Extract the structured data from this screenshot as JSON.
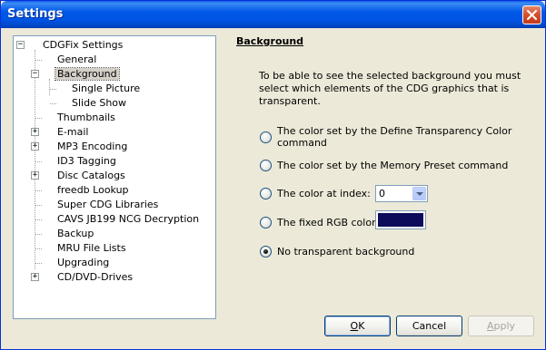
{
  "window": {
    "title": "Settings"
  },
  "tree": {
    "items": [
      {
        "label": "CDGFix Settings",
        "expander": "minus"
      },
      {
        "label": "General"
      },
      {
        "label": "Background",
        "expander": "minus",
        "selected": true
      },
      {
        "label": "Single Picture"
      },
      {
        "label": "Slide Show"
      },
      {
        "label": "Thumbnails"
      },
      {
        "label": "E-mail",
        "expander": "plus"
      },
      {
        "label": "MP3 Encoding",
        "expander": "plus"
      },
      {
        "label": "ID3 Tagging"
      },
      {
        "label": "Disc Catalogs",
        "expander": "plus"
      },
      {
        "label": "freedb Lookup"
      },
      {
        "label": "Super CDG Libraries"
      },
      {
        "label": "CAVS JB199 NCG Decryption"
      },
      {
        "label": "Backup"
      },
      {
        "label": "MRU File Lists"
      },
      {
        "label": "Upgrading"
      },
      {
        "label": "CD/DVD-Drives",
        "expander": "plus"
      }
    ]
  },
  "panel": {
    "title": "Background",
    "description": "To be able to see the selected background you must select which elements of the CDG graphics that is transparent.",
    "options": [
      {
        "label": "The color set by the Define Transparency Color command",
        "checked": false
      },
      {
        "label": "The color set by the Memory Preset command",
        "checked": false
      },
      {
        "label": "The color at index:",
        "checked": false
      },
      {
        "label": "The fixed RGB color:",
        "checked": false
      },
      {
        "label": "No transparent background",
        "checked": true
      }
    ],
    "color_index_value": "0",
    "rgb_color": "#0c0c5a"
  },
  "buttons": {
    "ok_mnemonic": "O",
    "ok_rest": "K",
    "cancel_label": "Cancel",
    "apply_mnemonic": "A",
    "apply_rest": "pply"
  },
  "colors": {
    "titlebar": "#0054e3",
    "close": "#d7512e",
    "window_bg": "#ece9d8"
  }
}
